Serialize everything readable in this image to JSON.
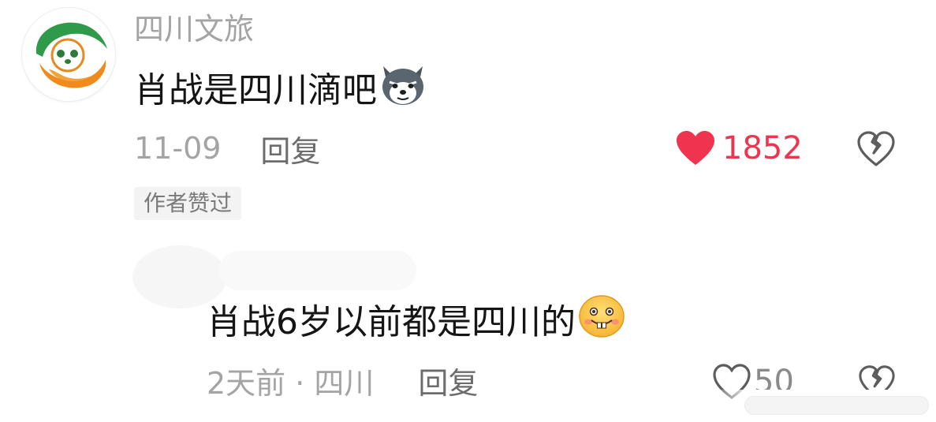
{
  "comment": {
    "username": "四川文旅",
    "text": "肖战是四川滴吧",
    "text_emoji": "dog-face-emoji",
    "date": "11-09",
    "reply_label": "回复",
    "like_count": "1852",
    "liked": true,
    "author_tag": "作者赞过"
  },
  "reply": {
    "text": "肖战6岁以前都是四川的",
    "text_emoji": "buck-teeth-smile-emoji",
    "time_location": "2天前 · 四川",
    "reply_label": "回复",
    "like_count": "50"
  },
  "colors": {
    "like_red": "#f0334f",
    "username_gray": "#a4a4a4",
    "text_dark": "#151515"
  }
}
